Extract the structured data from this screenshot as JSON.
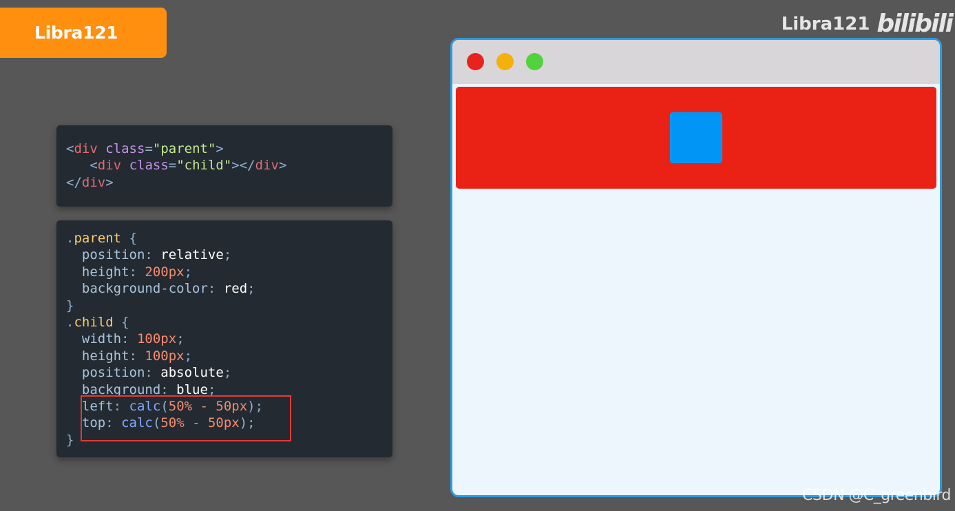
{
  "brand": {
    "badge_label": "Libra121",
    "badge_color": "#ff8f0f"
  },
  "watermarks": {
    "top_text": "Libra121",
    "top_logo": "bilibili",
    "bottom_text": "CSDN @C_greenbird"
  },
  "html_code": {
    "tag_div": "div",
    "attr_class": "class",
    "parent_class": "\"parent\"",
    "child_class": "\"child\""
  },
  "css_code": {
    "parent_selector": "parent",
    "child_selector": "child",
    "parent_rules": [
      {
        "prop": "position",
        "value": "relative"
      },
      {
        "prop": "height",
        "value": "200px"
      },
      {
        "prop": "background-color",
        "value": "red"
      }
    ],
    "child_rules": [
      {
        "prop": "width",
        "value": "100px"
      },
      {
        "prop": "height",
        "value": "100px"
      },
      {
        "prop": "position",
        "value": "absolute"
      },
      {
        "prop": "background",
        "value": "blue"
      },
      {
        "prop": "left",
        "fn": "calc",
        "value": "50% - 50px"
      },
      {
        "prop": "top",
        "fn": "calc",
        "value": "50% - 50px"
      }
    ]
  },
  "preview": {
    "parent_color": "#ea2216",
    "child_color": "#0196f6",
    "window_border_color": "#2d9be0",
    "traffic_lights": [
      "red",
      "yellow",
      "green"
    ]
  }
}
